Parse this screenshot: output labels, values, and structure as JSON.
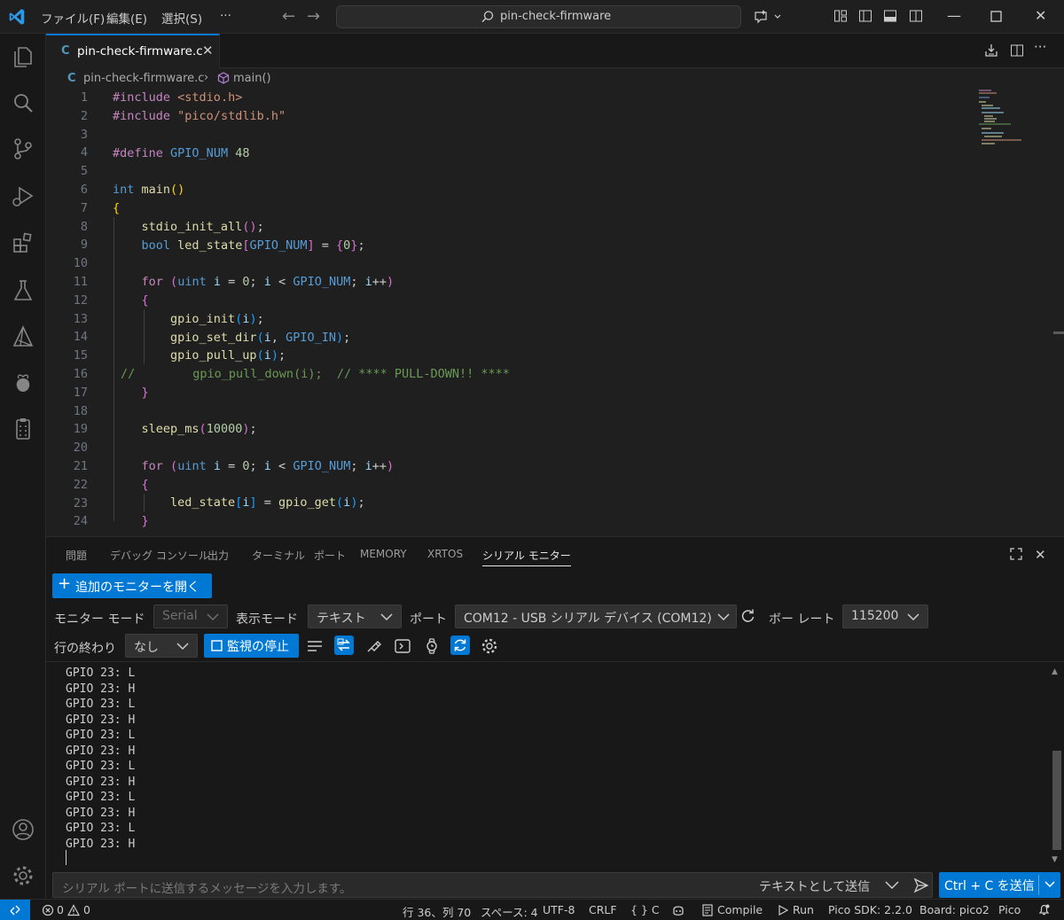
{
  "titlebar": {
    "menus": [
      "ファイル(F)",
      "編集(E)",
      "選択(S)",
      "···"
    ],
    "search_text": "pin-check-firmware"
  },
  "editor": {
    "tab_label": "pin-check-firmware.c",
    "tab_lang_badge": "C",
    "breadcrumb": {
      "file": "pin-check-firmware.c",
      "symbol": "main()"
    },
    "line_numbers": [
      "1",
      "2",
      "3",
      "4",
      "5",
      "6",
      "7",
      "8",
      "9",
      "10",
      "11",
      "12",
      "13",
      "14",
      "15",
      "16",
      "17",
      "18",
      "19",
      "20",
      "21",
      "22",
      "23",
      "24"
    ],
    "code_lines": [
      "#include <stdio.h>",
      "#include \"pico/stdlib.h\"",
      "",
      "#define GPIO_NUM 48",
      "",
      "int main()",
      "{",
      "    stdio_init_all();",
      "    bool led_state[GPIO_NUM] = {0};",
      "",
      "    for (uint i = 0; i < GPIO_NUM; i++)",
      "    {",
      "        gpio_init(i);",
      "        gpio_set_dir(i, GPIO_IN);",
      "        gpio_pull_up(i);",
      "//        gpio_pull_down(i);  // **** PULL-DOWN!! ****",
      "    }",
      "",
      "    sleep_ms(10000);",
      "",
      "    for (uint i = 0; i < GPIO_NUM; i++)",
      "    {",
      "        led_state[i] = gpio_get(i);",
      "    }"
    ]
  },
  "panel": {
    "tabs": [
      "問題",
      "デバッグ コンソール",
      "出力",
      "ターミナル",
      "ポート",
      "MEMORY",
      "XRTOS",
      "シリアル モニター"
    ],
    "active_tab": "シリアル モニター",
    "open_monitor_button": "追加のモニターを開く",
    "monitor_mode_label": "モニター モード",
    "monitor_mode_value": "Serial",
    "view_mode_label": "表示モード",
    "view_mode_value": "テキスト",
    "port_label": "ポート",
    "port_value": "COM12 - USB シリアル デバイス (COM12)",
    "baud_label": "ボー レート",
    "baud_value": "115200",
    "line_ending_label": "行の終わり",
    "line_ending_value": "なし",
    "stop_button": "監視の停止",
    "serial_lines": [
      "GPIO 23: L",
      "GPIO 23: H",
      "GPIO 23: L",
      "GPIO 23: H",
      "GPIO 23: L",
      "GPIO 23: H",
      "GPIO 23: L",
      "GPIO 23: H",
      "GPIO 23: L",
      "GPIO 23: H",
      "GPIO 23: L",
      "GPIO 23: H"
    ],
    "send_placeholder": "シリアル ポートに送信するメッセージを入力します。",
    "send_mode": "テキストとして送信",
    "send_button": "Ctrl + C を送信"
  },
  "statusbar": {
    "errors": "0",
    "warnings": "0",
    "position": "行 36、列 70",
    "spaces": "スペース: 4",
    "encoding": "UTF-8",
    "eol": "CRLF",
    "language": "{ } C",
    "compile": "Compile",
    "run": "Run",
    "sdk": "Pico SDK: 2.2.0",
    "board": "Board: pico2",
    "pico": "Pico"
  },
  "colors": {
    "accent": "#0078d4",
    "background": "#1f1f1f",
    "panel_background": "#181818"
  }
}
